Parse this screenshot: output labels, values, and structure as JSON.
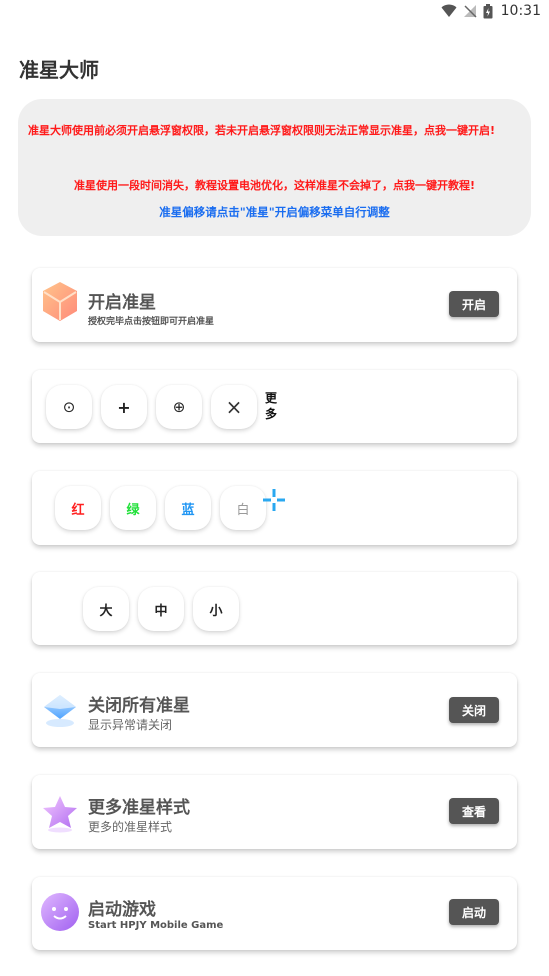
{
  "status_bar": {
    "time": "10:31"
  },
  "app": {
    "title": "准星大师"
  },
  "notice": {
    "line1": "准星大师使用前必须开启悬浮窗权限，若未开启悬浮窗权限则无法正常显示准星，点我一键开启!",
    "line2": "准星使用一段时间消失，教程设置电池优化，这样准星不会掉了，点我一键开教程!",
    "line3": "准星偏移请点击\"准星\"开启偏移菜单自行调整",
    "colors": {
      "warning": "#ff1a1a",
      "info": "#1a6df0"
    }
  },
  "enable_card": {
    "title": "开启准星",
    "subtitle": "授权完毕点击按钮即可开启准星",
    "button": "开启"
  },
  "styles_row": {
    "symbols": [
      "⊙",
      "+",
      "⊕",
      "×"
    ],
    "more_label": "更多"
  },
  "colors_row": {
    "options": [
      {
        "label": "红",
        "color": "#ff2020"
      },
      {
        "label": "绿",
        "color": "#22e03a"
      },
      {
        "label": "蓝",
        "color": "#2196f3"
      },
      {
        "label": "白",
        "color": "#9a9a9a"
      }
    ],
    "preview_color": "#2aa8f0"
  },
  "sizes_row": {
    "options": [
      "大",
      "中",
      "小"
    ]
  },
  "close_card": {
    "title": "关闭所有准星",
    "subtitle": "显示异常请关闭",
    "button": "关闭"
  },
  "more_card": {
    "title": "更多准星样式",
    "subtitle": "更多的准星样式",
    "button": "查看"
  },
  "game_card": {
    "title": "启动游戏",
    "subtitle": "Start HPJY Mobile Game",
    "button": "启动"
  }
}
